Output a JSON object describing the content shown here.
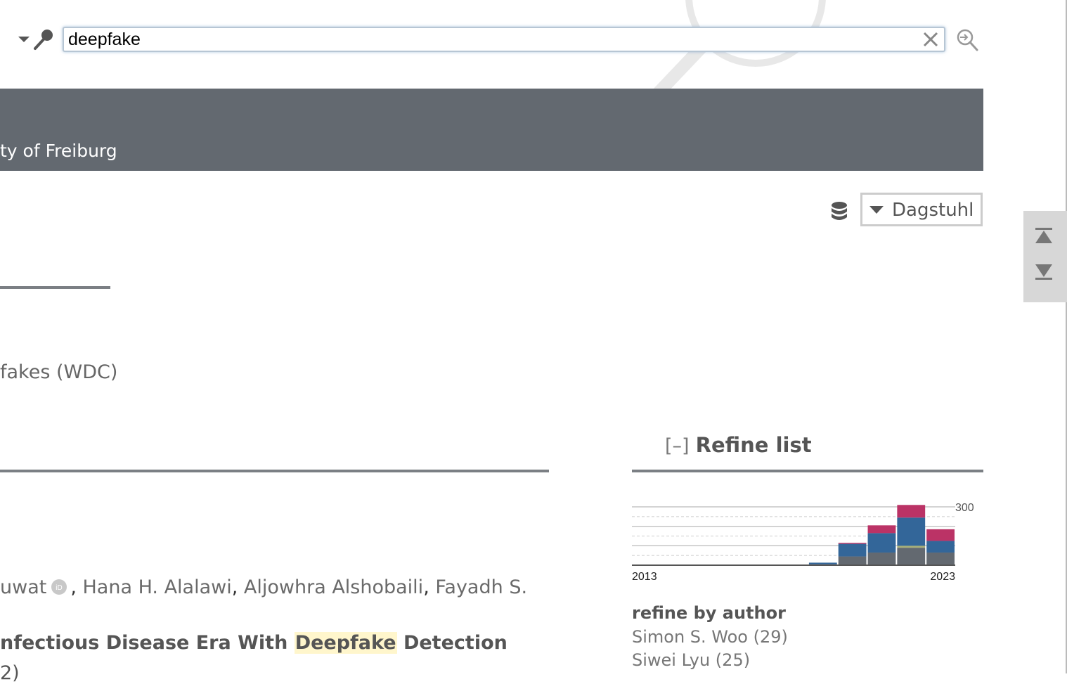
{
  "search": {
    "query": "deepfake"
  },
  "banner": {
    "text": "ty of Freiburg"
  },
  "mirror": {
    "selected": "Dagstuhl"
  },
  "venue_fragment": "fakes (WDC)",
  "result": {
    "authors": [
      {
        "name": "uwat",
        "orcid": true
      },
      {
        "name": "Hana H. Alalawi",
        "orcid": false
      },
      {
        "name": "Aljowhra Alshobaili",
        "orcid": false
      },
      {
        "name": "Fayadh S.",
        "orcid": false
      }
    ],
    "title_before": "nfectious Disease Era With ",
    "title_highlight": "Deepfake",
    "title_after": " Detection",
    "next_fragment": "2)"
  },
  "refine": {
    "toggle": "[–]",
    "title": "Refine list",
    "author_heading": "refine by author",
    "authors": [
      "Simon S. Woo (29)",
      "Siwei Lyu (25)"
    ]
  },
  "chart_data": {
    "type": "bar",
    "stacked": true,
    "categories": [
      "2013",
      "2014",
      "2015",
      "2016",
      "2017",
      "2018",
      "2019",
      "2020",
      "2021",
      "2022",
      "2023"
    ],
    "series": [
      {
        "color": "#636970",
        "values": [
          0,
          0,
          0,
          0,
          0,
          0,
          5,
          45,
          65,
          90,
          65
        ]
      },
      {
        "color": "#a8b078",
        "values": [
          0,
          0,
          0,
          0,
          0,
          0,
          0,
          0,
          0,
          10,
          0
        ]
      },
      {
        "color": "#336699",
        "values": [
          0,
          0,
          0,
          0,
          0,
          0,
          8,
          65,
          100,
          145,
          60
        ]
      },
      {
        "color": "#bb3366",
        "values": [
          0,
          0,
          0,
          0,
          0,
          0,
          0,
          5,
          40,
          65,
          60
        ]
      }
    ],
    "x_tick_labels": [
      "2013",
      "2023"
    ],
    "y_tick_label": "300",
    "y_tick_value": 300,
    "ylim": [
      0,
      340
    ],
    "grid": true
  }
}
